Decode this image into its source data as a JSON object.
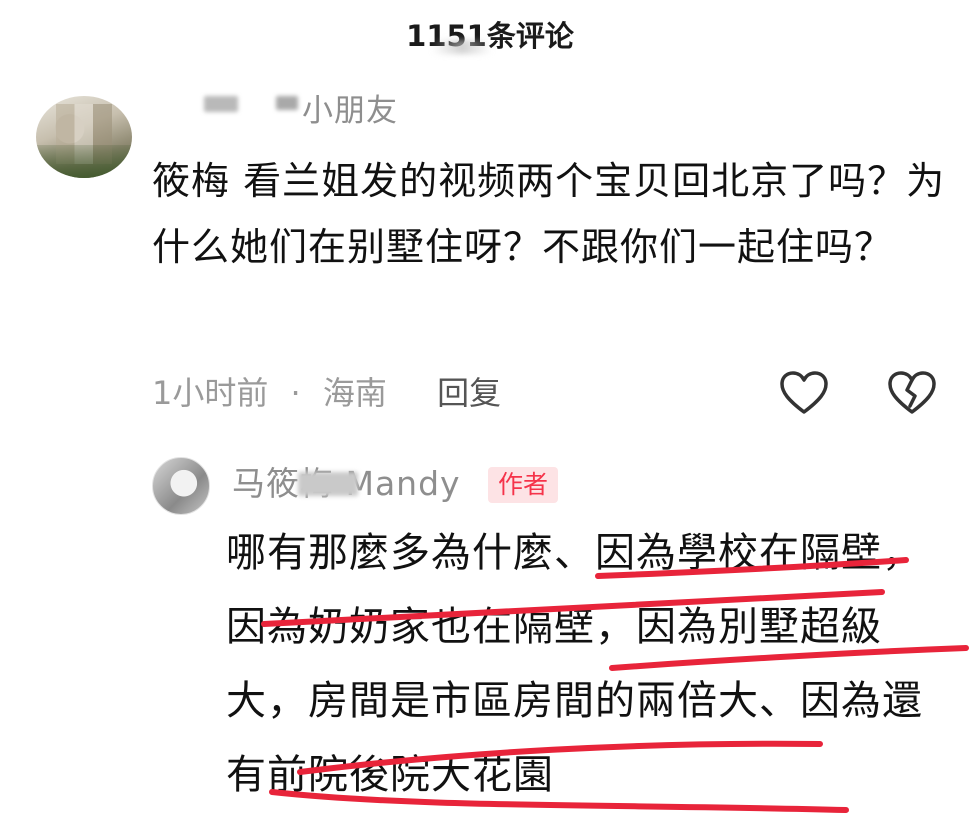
{
  "header": {
    "title": "1151条评论"
  },
  "comment": {
    "username": "小朋友",
    "text": "筱梅 看兰姐发的视频两个宝贝回北京了吗？为什么她们在别墅住呀？不跟你们一起住吗？",
    "time": "1小时前",
    "separator": "·",
    "location": "海南",
    "reply_label": "回复",
    "like_icon": "heart-outline-icon",
    "dislike_icon": "broken-heart-icon"
  },
  "reply": {
    "username": "马筱梅 Mandy",
    "badge": "作者",
    "text": "哪有那麼多為什麼、因為學校在隔壁，因為奶奶家也在隔壁，因為別墅超級大，房間是市區房間的兩倍大、因為還有前院後院大花園"
  },
  "colors": {
    "badge_text": "#f5334a",
    "badge_bg": "#fde3e5",
    "underline": "#e8243a",
    "meta_text": "#9a9a9a"
  }
}
